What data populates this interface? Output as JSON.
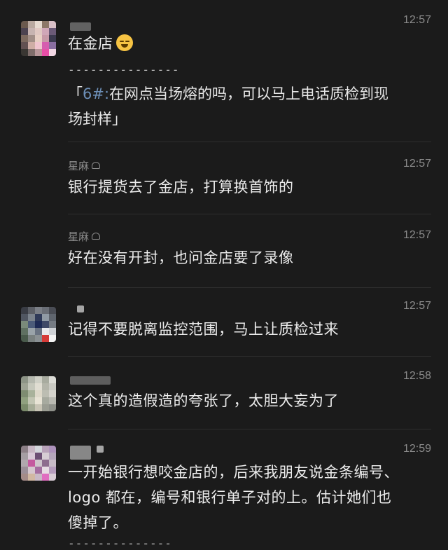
{
  "messages": [
    {
      "time": "12:57",
      "text": "在金店",
      "divider": "---------------",
      "quote_bracket_open": "「",
      "quote_ref": "6#:",
      "quote_text": "在网点当场熔的吗，可以马上电话质检到现",
      "quote_text2": "场封样」"
    },
    {
      "name": "星麻",
      "time": "12:57",
      "text": "银行提货去了金店，打算换首饰的"
    },
    {
      "name": "星麻",
      "time": "12:57",
      "text": "好在没有开封，也问金店要了录像"
    },
    {
      "time": "12:57",
      "text": "记得不要脱离监控范围，马上让质检过来"
    },
    {
      "time": "12:58",
      "text": "这个真的造假造的夸张了，太胆大妄为了"
    },
    {
      "time": "12:59",
      "line1": "一开始银行想咬金店的，后来我朋友说金条编号、",
      "line2": "logo 都在，编号和银行单子对的上。估计她们也",
      "line3": "傻掉了。",
      "divider": "--------------"
    }
  ],
  "colors": {
    "background": "#1b1b1b",
    "text": "#ececec",
    "meta": "#8c8c8c",
    "quote_ref": "#6d8fb7"
  },
  "icons": [
    "laughing-crying-emoji",
    "heart-icon"
  ]
}
